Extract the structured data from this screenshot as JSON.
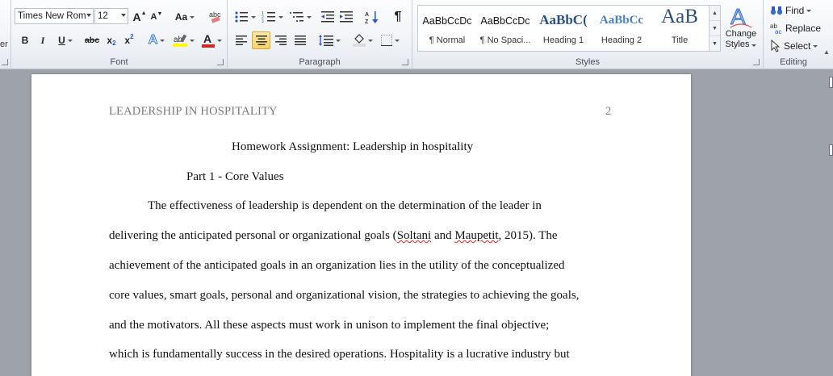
{
  "font": {
    "group_label": "Font",
    "font_name": "Times New Rom",
    "font_size": "12",
    "grow_label": "A",
    "shrink_label": "A",
    "change_case_label": "Aa",
    "bold": "B",
    "italic": "I",
    "underline": "U",
    "strike": "abc",
    "subscript": "x",
    "superscript": "x",
    "highlight_color": "#ffff00",
    "font_color": "#e02020"
  },
  "paragraph": {
    "group_label": "Paragraph",
    "show_marks": "¶"
  },
  "styles": {
    "group_label": "Styles",
    "items": [
      {
        "sample": "AaBbCcDc",
        "name": "¶ Normal"
      },
      {
        "sample": "AaBbCcDc",
        "name": "¶ No Spaci..."
      },
      {
        "sample": "AaBbC(",
        "name": "Heading 1"
      },
      {
        "sample": "AaBbCc",
        "name": "Heading 2"
      },
      {
        "sample": "AaB",
        "name": "Title"
      }
    ],
    "change_styles_line1": "Change",
    "change_styles_line2": "Styles"
  },
  "editing": {
    "group_label": "Editing",
    "find": "Find",
    "replace": "Replace",
    "select": "Select"
  },
  "left_clip": "er",
  "document": {
    "running_head": "LEADERSHIP IN HOSPITALITY",
    "page_number": "2",
    "title": "Homework Assignment: Leadership in hospitality",
    "section": "Part 1 - Core Values",
    "line1": "The effectiveness of leadership is dependent on the determination of the leader in",
    "line2_a": "delivering the anticipated personal or organizational  goals (",
    "line2_s1": "Soltani",
    "line2_b": " and ",
    "line2_s2": "Maupetit",
    "line2_c": ", 2015). The",
    "line3": "achievement of the anticipated goals in an organization lies in the utility of the conceptualized",
    "line4": "core values, smart goals, personal and organizational  vision, the strategies to achieving the goals,",
    "line5": "and the motivators. All these aspects must work in unison to implement  the final objective;",
    "line6": "which is fundamentally success in the desired operations. Hospitality is a lucrative industry but"
  }
}
